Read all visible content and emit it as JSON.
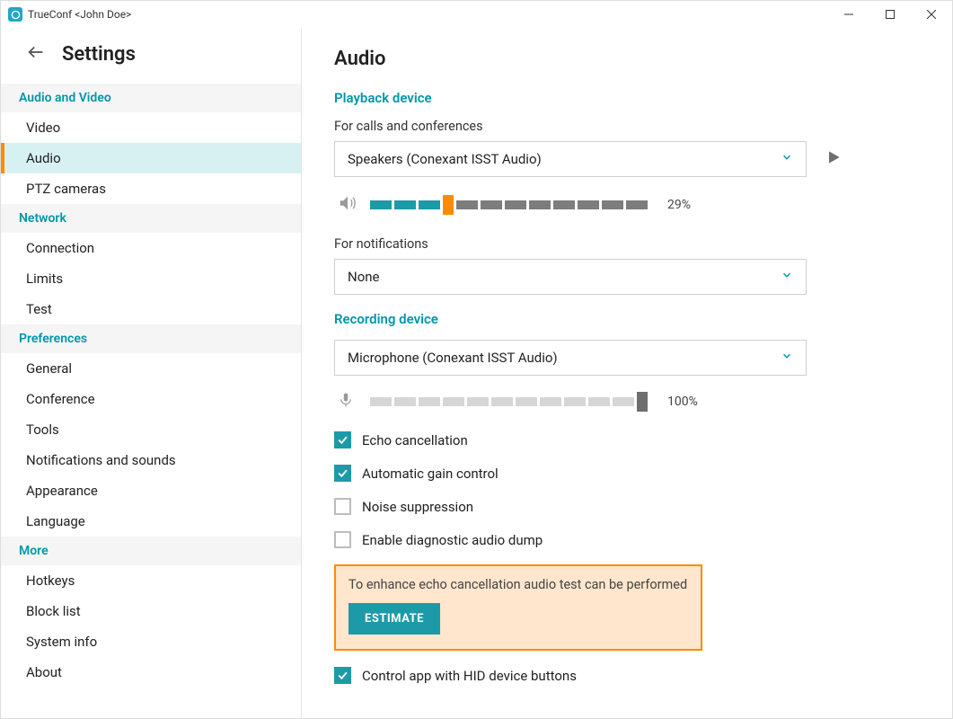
{
  "window": {
    "title": "TrueConf <John Doe>"
  },
  "sidebar": {
    "heading": "Settings",
    "sections": [
      {
        "title": "Audio and Video",
        "items": [
          "Video",
          "Audio",
          "PTZ cameras"
        ],
        "activeIndex": 1
      },
      {
        "title": "Network",
        "items": [
          "Connection",
          "Limits",
          "Test"
        ]
      },
      {
        "title": "Preferences",
        "items": [
          "General",
          "Conference",
          "Tools",
          "Notifications and sounds",
          "Appearance",
          "Language"
        ]
      },
      {
        "title": "More",
        "items": [
          "Hotkeys",
          "Block list",
          "System info",
          "About"
        ]
      }
    ]
  },
  "page": {
    "title": "Audio",
    "playback": {
      "heading": "Playback device",
      "callsLabel": "For calls and conferences",
      "callsDevice": "Speakers (Conexant ISST Audio)",
      "volumePct": "29%",
      "volumeFilled": 3,
      "volumeTotal": 11,
      "notifLabel": "For notifications",
      "notifDevice": "None"
    },
    "recording": {
      "heading": "Recording device",
      "device": "Microphone (Conexant ISST Audio)",
      "levelPct": "100%",
      "levelFilled": 11,
      "levelTotal": 11,
      "checks": {
        "echo": {
          "label": "Echo cancellation",
          "on": true
        },
        "agc": {
          "label": "Automatic gain control",
          "on": true
        },
        "noise": {
          "label": "Noise suppression",
          "on": false
        },
        "dump": {
          "label": "Enable diagnostic audio dump",
          "on": false
        }
      }
    },
    "estimate": {
      "text": "To enhance echo cancellation audio test can be performed",
      "button": "ESTIMATE"
    },
    "hid": {
      "label": "Control app with HID device buttons",
      "on": true
    }
  }
}
